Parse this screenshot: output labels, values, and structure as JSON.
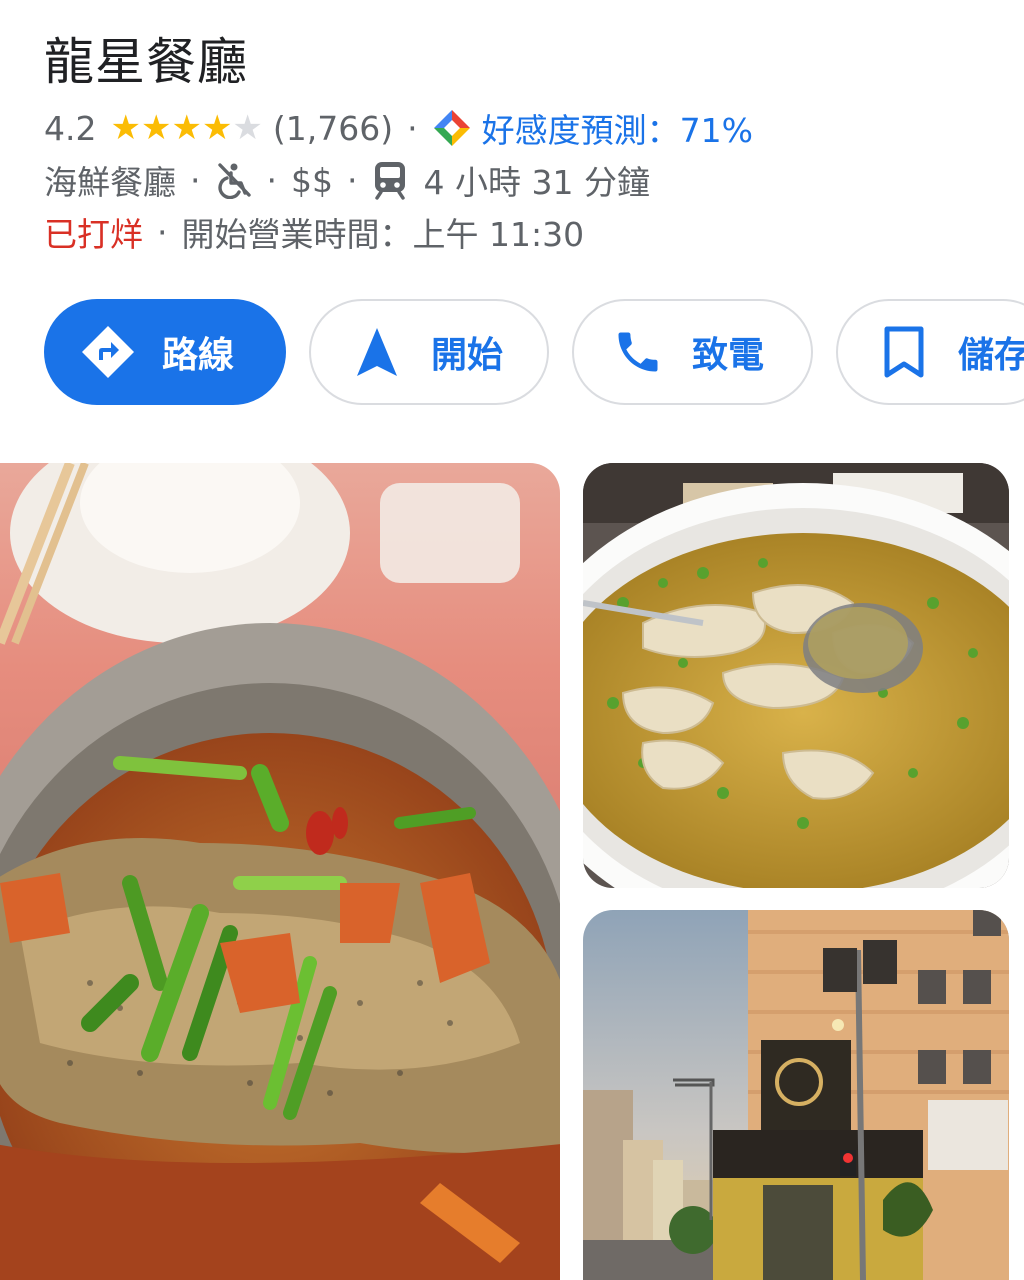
{
  "place": {
    "name": "龍星餐廳",
    "rating": "4.2",
    "rating_value": 4.2,
    "review_count": "(1,766)",
    "separator": "·",
    "prediction_label": "好感度預測：71%",
    "category": "海鮮餐廳",
    "price": "$$",
    "travel_time": "4 小時 31 分鐘",
    "status": "已打烊",
    "open_info": "開始營業時間：上午 11:30"
  },
  "actions": {
    "directions": "路線",
    "start": "開始",
    "call": "致電",
    "save": "儲存"
  },
  "colors": {
    "accent": "#1a73e8",
    "star": "#fbbc04",
    "closed": "#d93025",
    "secondary_text": "#5f6368"
  },
  "icons": [
    "directions-icon",
    "navigation-arrow-icon",
    "phone-icon",
    "bookmark-icon",
    "not-wheelchair-accessible-icon",
    "transit-icon",
    "google-prediction-icon",
    "star-icon"
  ],
  "photos": [
    "steamed-fish-photo",
    "fish-soup-photo",
    "restaurant-exterior-photo"
  ]
}
